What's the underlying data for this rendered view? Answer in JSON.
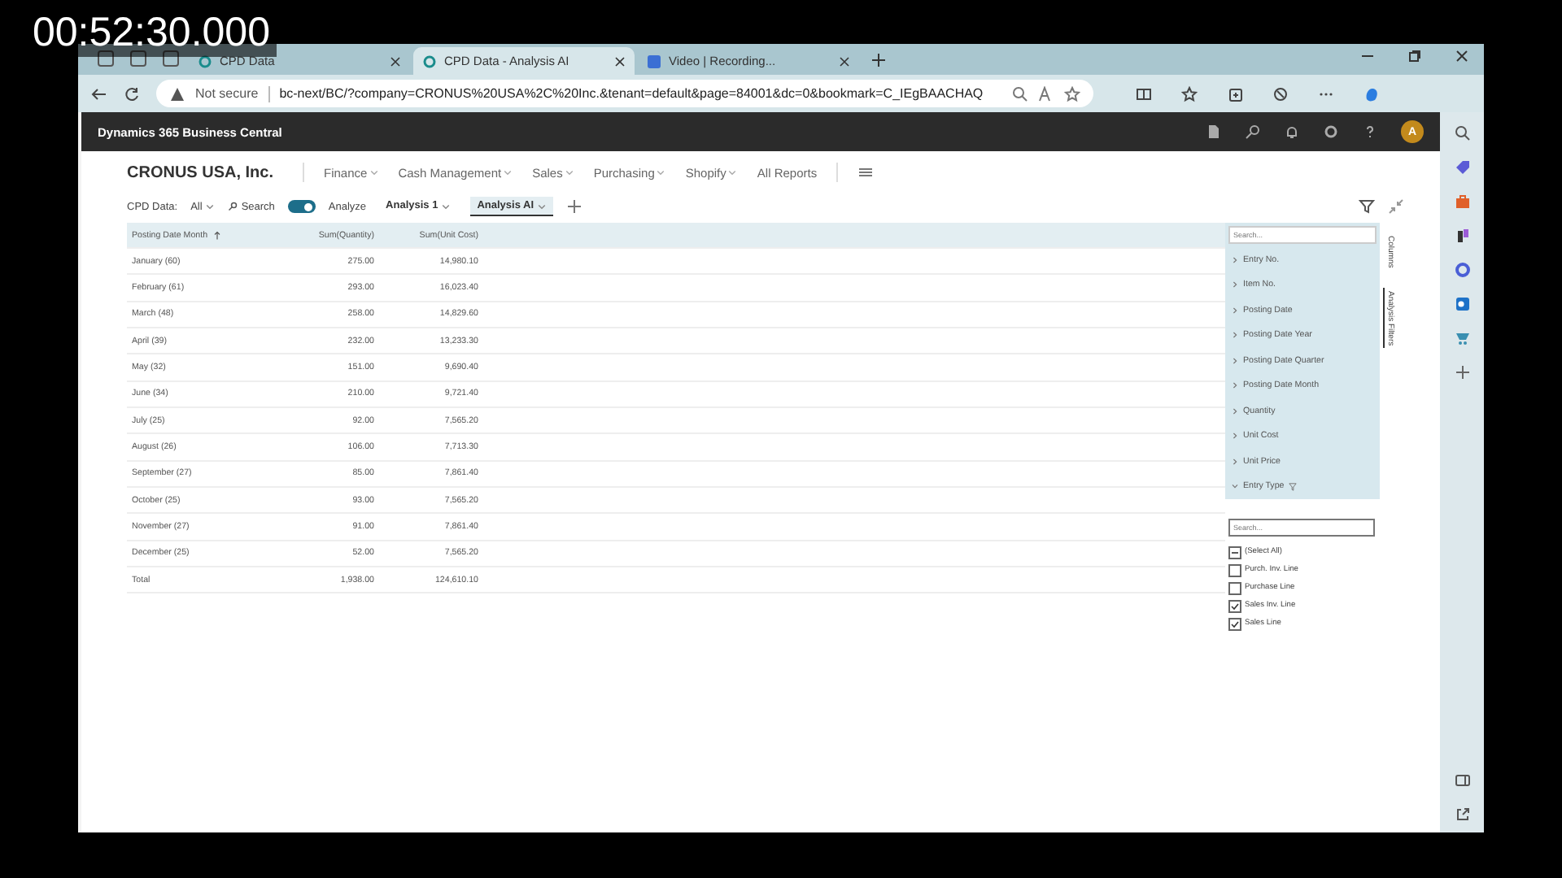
{
  "timestamp": "00:52:30.000",
  "browser": {
    "tabs": [
      {
        "label": "CPD Data",
        "selected": false
      },
      {
        "label": "CPD Data - Analysis AI",
        "selected": true
      },
      {
        "label": "Video | Recording...",
        "selected": false
      }
    ],
    "security": "Not secure",
    "url": "bc-next/BC/?company=CRONUS%20USA%2C%20Inc.&tenant=default&page=84001&dc=0&bookmark=C_IEgBAACHAQ"
  },
  "app": {
    "title": "Dynamics 365 Business Central",
    "avatar": "A"
  },
  "company": "CRONUS USA, Inc.",
  "nav": [
    {
      "label": "Finance",
      "dropdown": true
    },
    {
      "label": "Cash Management",
      "dropdown": true
    },
    {
      "label": "Sales",
      "dropdown": true
    },
    {
      "label": "Purchasing",
      "dropdown": true
    },
    {
      "label": "Shopify",
      "dropdown": true
    },
    {
      "label": "All Reports",
      "dropdown": false
    }
  ],
  "action_bar": {
    "filter_label": "CPD Data:",
    "filter_value": "All",
    "search": "Search",
    "analyze": {
      "label": "Analyze",
      "on": true
    },
    "tabs": [
      {
        "label": "Analysis 1",
        "selected": false
      },
      {
        "label": "Analysis AI",
        "selected": true
      }
    ]
  },
  "table": {
    "columns": [
      {
        "label": "Posting Date Month",
        "sorted": true
      },
      {
        "label": "Sum(Quantity)",
        "sorted": false
      },
      {
        "label": "Sum(Unit Cost)",
        "sorted": false
      }
    ],
    "rows": [
      [
        "January (60)",
        "275.00",
        "14,980.10"
      ],
      [
        "February (61)",
        "293.00",
        "16,023.40"
      ],
      [
        "March (48)",
        "258.00",
        "14,829.60"
      ],
      [
        "April (39)",
        "232.00",
        "13,233.30"
      ],
      [
        "May (32)",
        "151.00",
        "9,690.40"
      ],
      [
        "June (34)",
        "210.00",
        "9,721.40"
      ],
      [
        "July (25)",
        "92.00",
        "7,565.20"
      ],
      [
        "August (26)",
        "106.00",
        "7,713.30"
      ],
      [
        "September (27)",
        "85.00",
        "7,861.40"
      ],
      [
        "October (25)",
        "93.00",
        "7,565.20"
      ],
      [
        "November (27)",
        "91.00",
        "7,861.40"
      ],
      [
        "December (25)",
        "52.00",
        "7,565.20"
      ],
      [
        "Total",
        "1,938.00",
        "124,610.10"
      ]
    ]
  },
  "fields_panel": {
    "placeholder": "Search...",
    "fields": [
      {
        "label": "Entry No.",
        "expanded": false,
        "filtered": false
      },
      {
        "label": "Item No.",
        "expanded": false,
        "filtered": false
      },
      {
        "label": "Posting Date",
        "expanded": false,
        "filtered": false
      },
      {
        "label": "Posting Date Year",
        "expanded": false,
        "filtered": false
      },
      {
        "label": "Posting Date Quarter",
        "expanded": false,
        "filtered": false
      },
      {
        "label": "Posting Date Month",
        "expanded": false,
        "filtered": false
      },
      {
        "label": "Quantity",
        "expanded": false,
        "filtered": false
      },
      {
        "label": "Unit Cost",
        "expanded": false,
        "filtered": false
      },
      {
        "label": "Unit Price",
        "expanded": false,
        "filtered": false
      },
      {
        "label": "Entry Type",
        "expanded": true,
        "filtered": true
      }
    ],
    "filter_placeholder": "Search...",
    "select_all": {
      "label": "(Select All)",
      "partial": true
    },
    "options": [
      {
        "label": "Purch. Inv. Line",
        "checked": false
      },
      {
        "label": "Purchase Line",
        "checked": false
      },
      {
        "label": "Sales Inv. Line",
        "checked": true
      },
      {
        "label": "Sales Line",
        "checked": true
      }
    ]
  },
  "side_tabs": [
    {
      "label": "Columns",
      "selected": false
    },
    {
      "label": "Analysis Filters",
      "selected": true
    }
  ]
}
